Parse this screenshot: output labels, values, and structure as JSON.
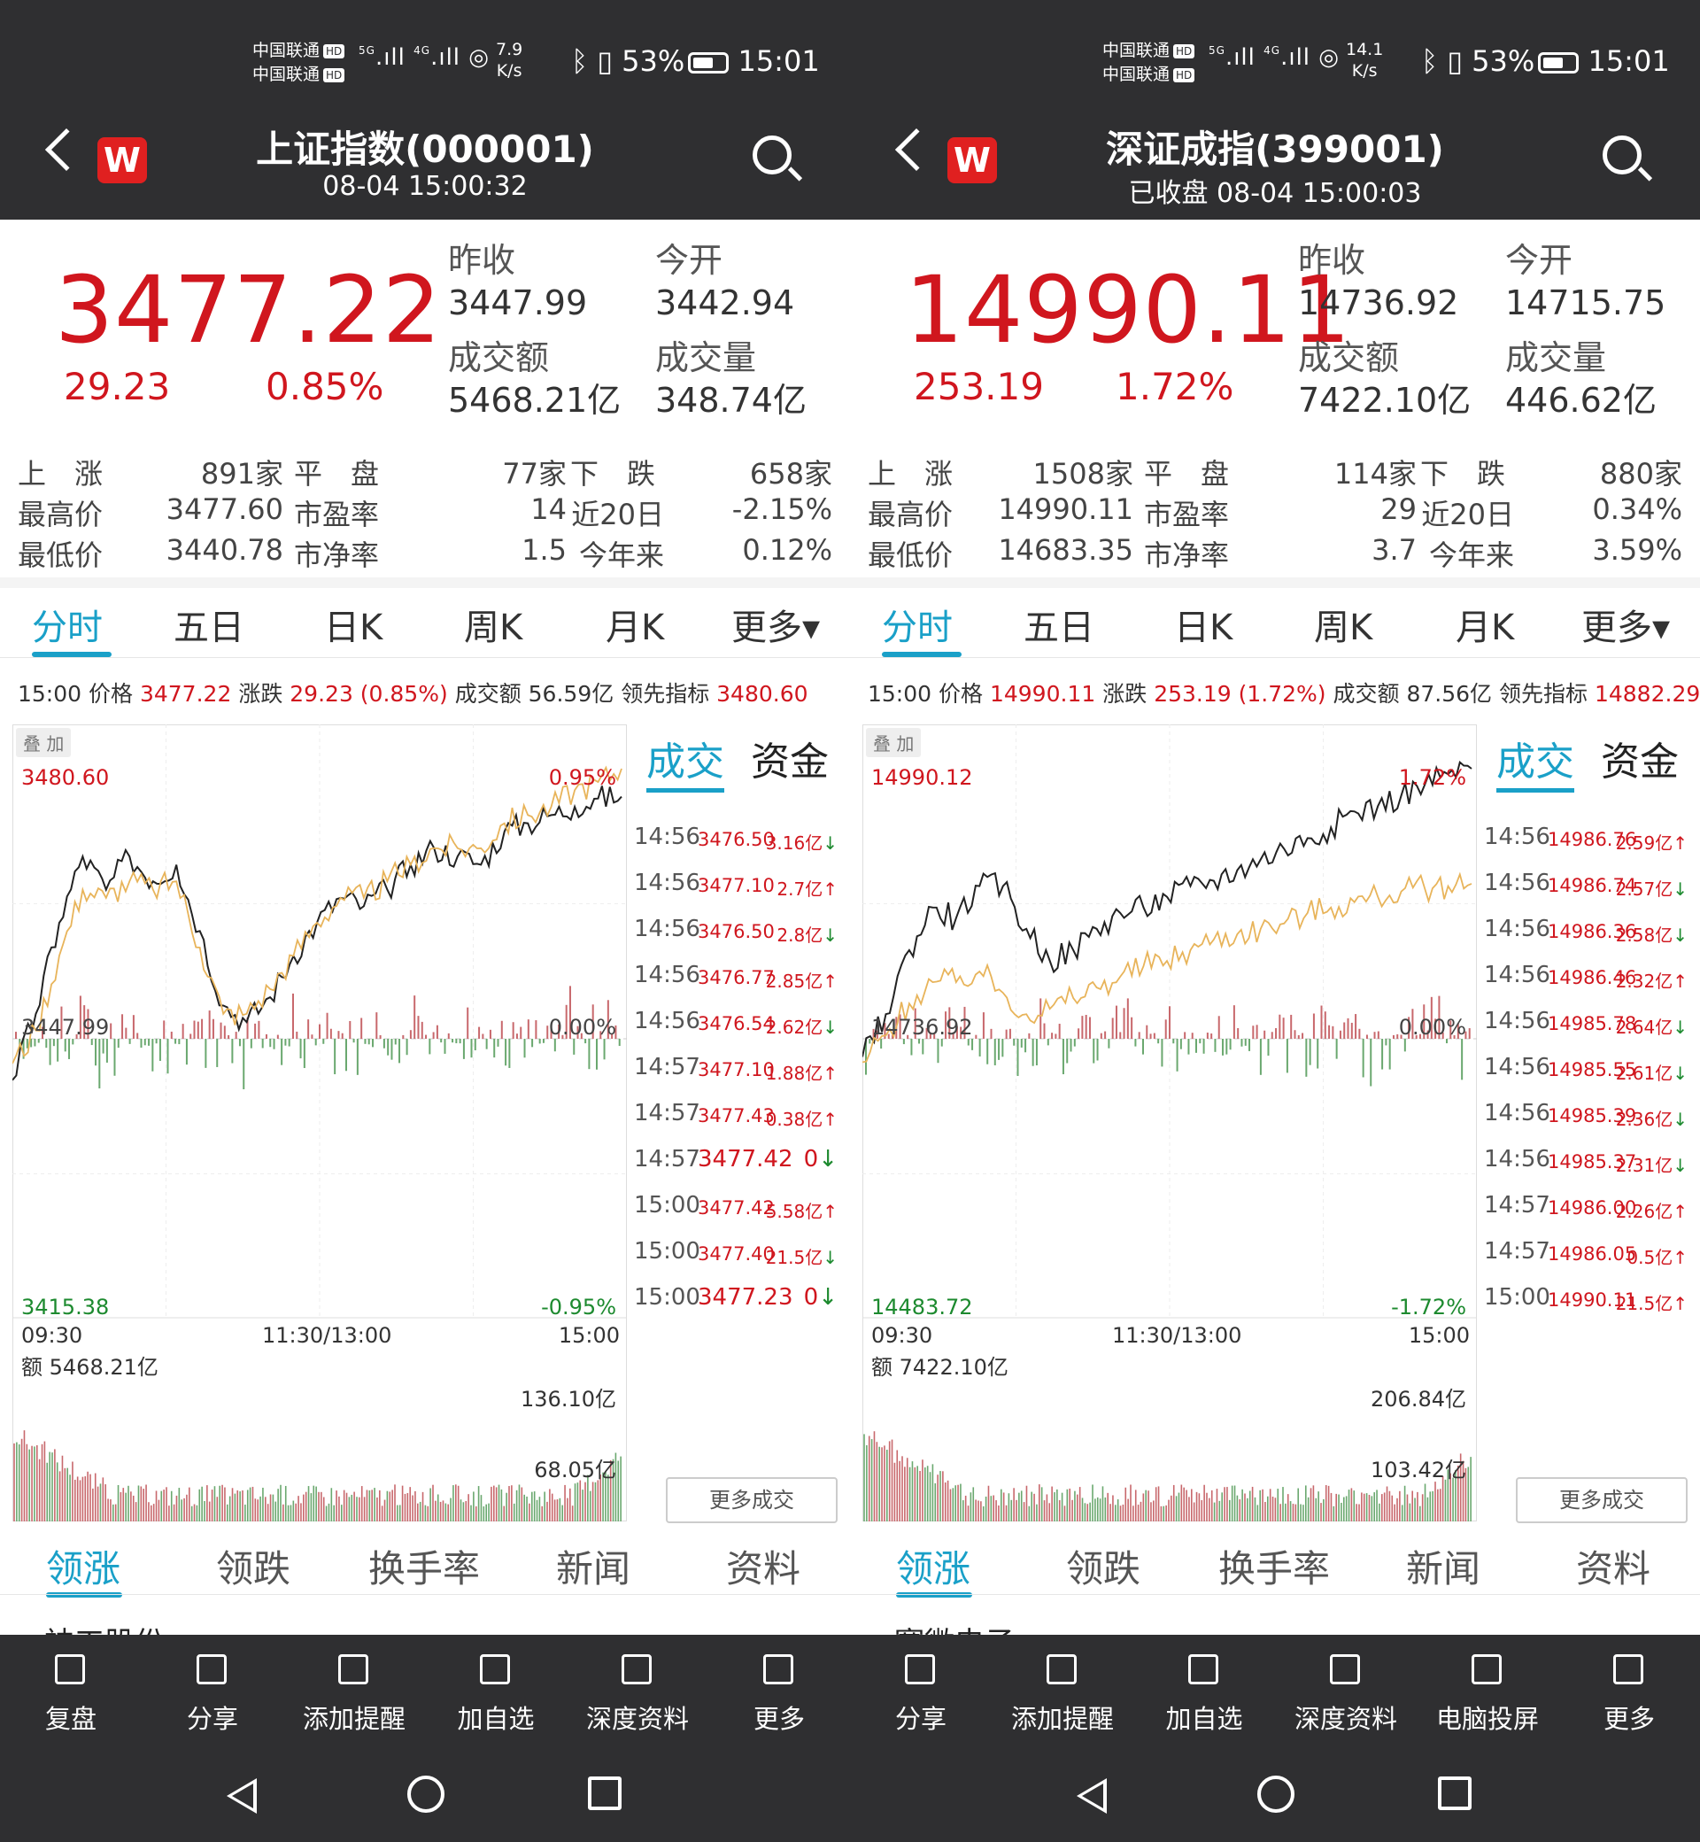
{
  "status_bar": {
    "carrier1": "中国联通",
    "carrier2": "中国联通",
    "hd": "HD",
    "battery": "53%",
    "time": "15:01",
    "network1": "5G",
    "network2": "4G"
  },
  "panels": [
    {
      "speed_value": "7.9",
      "speed_unit": "K/s",
      "title": "上证指数(000001)",
      "subtitle": "08-04 15:00:32",
      "price": "3477.22",
      "change": "29.23",
      "change_pct": "0.85%",
      "prev_close_label": "昨收",
      "prev_close": "3447.99",
      "open_label": "今开",
      "open": "3442.94",
      "turnover_label": "成交额",
      "turnover": "5468.21亿",
      "volume_label": "成交量",
      "volume": "348.74亿",
      "up_label": "上　涨",
      "up_count": "891家",
      "flat_label": "平　盘",
      "flat_count": "77家",
      "down_label": "下　跌",
      "down_count": "658家",
      "high_label": "最高价",
      "high": "3477.60",
      "pe_label": "市盈率",
      "pe": "14",
      "d20_label": "近20日",
      "d20": "-2.15%",
      "low_label": "最低价",
      "low": "3440.78",
      "pb_label": "市净率",
      "pb": "1.5",
      "ytd_label": "今年来",
      "ytd": "0.12%",
      "period_tabs": [
        "分时",
        "五日",
        "日K",
        "周K",
        "月K",
        "更多▾"
      ],
      "info": {
        "time": "15:00",
        "price_label": "价格",
        "price": "3477.22",
        "chg_label": "涨跌",
        "chg": "29.23 (0.85%)",
        "amt_label": "成交额",
        "amt": "56.59亿",
        "lead_label": "领先指标",
        "lead": "3480.60"
      },
      "overlay_label": "叠 加",
      "chart": {
        "top_price": "3480.60",
        "top_pct": "0.95%",
        "mid_price": "3447.99",
        "mid_pct": "0.00%",
        "bot_price": "3415.38",
        "bot_pct": "-0.95%",
        "t_start": "09:30",
        "t_mid": "11:30/13:00",
        "t_end": "15:00",
        "vol_label": "额",
        "vol_total": "5468.21亿",
        "vol_top": "136.10亿",
        "vol_mid": "68.05亿"
      },
      "chart_data": {
        "type": "line",
        "title": "",
        "ylim": [
          3415.38,
          3480.6
        ],
        "prev_close": 3447.99,
        "x_ticks": [
          "09:30",
          "11:30/13:00",
          "15:00"
        ],
        "series": [
          {
            "color": "#222222",
            "values": [
              3443,
              3451,
              3462,
              3470,
              3466,
              3470,
              3467,
              3469,
              3461,
              3452,
              3450,
              3453,
              3458,
              3462,
              3465,
              3464,
              3466,
              3469,
              3471,
              3470,
              3469,
              3473,
              3474,
              3475,
              3476,
              3477,
              3477.22
            ]
          },
          {
            "color": "#e8b45a",
            "values": [
              3445,
              3449,
              3458,
              3466,
              3465,
              3467,
              3466,
              3467,
              3459,
              3451,
              3451,
              3454,
              3458,
              3462,
              3465,
              3465,
              3467,
              3469,
              3471,
              3471,
              3471,
              3474,
              3475,
              3476,
              3478,
              3479,
              3480.6
            ]
          }
        ],
        "volume_ylim": [
          0,
          136.1
        ]
      },
      "trade_tabs": [
        "成交",
        "资金"
      ],
      "trades": [
        {
          "time": "14:56",
          "price": "3476.50",
          "amt": "3.16亿",
          "dir": "↓"
        },
        {
          "time": "14:56",
          "price": "3477.10",
          "amt": "2.7亿",
          "dir": "↑"
        },
        {
          "time": "14:56",
          "price": "3476.50",
          "amt": "2.8亿",
          "dir": "↓"
        },
        {
          "time": "14:56",
          "price": "3476.77",
          "amt": "2.85亿",
          "dir": "↑"
        },
        {
          "time": "14:56",
          "price": "3476.54",
          "amt": "2.62亿",
          "dir": "↓"
        },
        {
          "time": "14:57",
          "price": "3477.10",
          "amt": "1.88亿",
          "dir": "↑"
        },
        {
          "time": "14:57",
          "price": "3477.43",
          "amt": "0.38亿",
          "dir": "↑"
        },
        {
          "time": "14:57",
          "price": "3477.42",
          "amt": "0",
          "dir": "↓"
        },
        {
          "time": "15:00",
          "price": "3477.42",
          "amt": "5.58亿",
          "dir": "↑"
        },
        {
          "time": "15:00",
          "price": "3477.40",
          "amt": "21.5亿",
          "dir": "↓"
        },
        {
          "time": "15:00",
          "price": "3477.23",
          "amt": "0",
          "dir": "↓"
        }
      ],
      "more_trades": "更多成交",
      "bottom_tabs": [
        "领涨",
        "领跌",
        "换手率",
        "新闻",
        "资料"
      ],
      "peek_text": "神工股份",
      "toolbar": [
        "复盘",
        "分享",
        "添加提醒",
        "加自选",
        "深度资料",
        "更多"
      ]
    },
    {
      "speed_value": "14.1",
      "speed_unit": "K/s",
      "title": "深证成指(399001)",
      "subtitle": "已收盘 08-04 15:00:03",
      "price": "14990.11",
      "change": "253.19",
      "change_pct": "1.72%",
      "prev_close_label": "昨收",
      "prev_close": "14736.92",
      "open_label": "今开",
      "open": "14715.75",
      "turnover_label": "成交额",
      "turnover": "7422.10亿",
      "volume_label": "成交量",
      "volume": "446.62亿",
      "up_label": "上　涨",
      "up_count": "1508家",
      "flat_label": "平　盘",
      "flat_count": "114家",
      "down_label": "下　跌",
      "down_count": "880家",
      "high_label": "最高价",
      "high": "14990.11",
      "pe_label": "市盈率",
      "pe": "29",
      "d20_label": "近20日",
      "d20": "0.34%",
      "low_label": "最低价",
      "low": "14683.35",
      "pb_label": "市净率",
      "pb": "3.7",
      "ytd_label": "今年来",
      "ytd": "3.59%",
      "period_tabs": [
        "分时",
        "五日",
        "日K",
        "周K",
        "月K",
        "更多▾"
      ],
      "info": {
        "time": "15:00",
        "price_label": "价格",
        "price": "14990.11",
        "chg_label": "涨跌",
        "chg": "253.19 (1.72%)",
        "amt_label": "成交额",
        "amt": "87.56亿",
        "lead_label": "领先指标",
        "lead": "14882.29"
      },
      "overlay_label": "叠 加",
      "chart": {
        "top_price": "14990.12",
        "top_pct": "1.72%",
        "mid_price": "14736.92",
        "mid_pct": "0.00%",
        "bot_price": "14483.72",
        "bot_pct": "-1.72%",
        "t_start": "09:30",
        "t_mid": "11:30/13:00",
        "t_end": "15:00",
        "vol_label": "额",
        "vol_total": "7422.10亿",
        "vol_top": "206.84亿",
        "vol_mid": "103.42亿"
      },
      "chart_data": {
        "type": "line",
        "title": "",
        "ylim": [
          14483.72,
          14990.12
        ],
        "prev_close": 14736.92,
        "x_ticks": [
          "09:30",
          "11:30/13:00",
          "15:00"
        ],
        "series": [
          {
            "color": "#222222",
            "values": [
              14720,
              14760,
              14820,
              14860,
              14850,
              14880,
              14880,
              14840,
              14810,
              14820,
              14840,
              14855,
              14860,
              14870,
              14880,
              14885,
              14895,
              14905,
              14915,
              14925,
              14935,
              14950,
              14955,
              14965,
              14975,
              14985,
              14990.11
            ]
          },
          {
            "color": "#e8b45a",
            "values": [
              14715,
              14740,
              14770,
              14790,
              14790,
              14800,
              14780,
              14760,
              14765,
              14775,
              14785,
              14795,
              14805,
              14810,
              14820,
              14830,
              14835,
              14840,
              14845,
              14855,
              14860,
              14865,
              14870,
              14875,
              14878,
              14880,
              14882.29
            ]
          }
        ],
        "volume_ylim": [
          0,
          206.84
        ]
      },
      "trade_tabs": [
        "成交",
        "资金"
      ],
      "trades": [
        {
          "time": "14:56",
          "price": "14986.76",
          "amt": "2.59亿",
          "dir": "↑"
        },
        {
          "time": "14:56",
          "price": "14986.74",
          "amt": "2.57亿",
          "dir": "↓"
        },
        {
          "time": "14:56",
          "price": "14986.36",
          "amt": "2.58亿",
          "dir": "↓"
        },
        {
          "time": "14:56",
          "price": "14986.46",
          "amt": "2.32亿",
          "dir": "↑"
        },
        {
          "time": "14:56",
          "price": "14985.78",
          "amt": "2.64亿",
          "dir": "↓"
        },
        {
          "time": "14:56",
          "price": "14985.55",
          "amt": "2.61亿",
          "dir": "↓"
        },
        {
          "time": "14:56",
          "price": "14985.39",
          "amt": "2.36亿",
          "dir": "↓"
        },
        {
          "time": "14:56",
          "price": "14985.37",
          "amt": "2.31亿",
          "dir": "↓"
        },
        {
          "time": "14:57",
          "price": "14986.00",
          "amt": "2.26亿",
          "dir": "↑"
        },
        {
          "time": "14:57",
          "price": "14986.05",
          "amt": "0.5亿",
          "dir": "↑"
        },
        {
          "time": "15:00",
          "price": "14990.11",
          "amt": "21.5亿",
          "dir": "↑"
        }
      ],
      "more_trades": "更多成交",
      "bottom_tabs": [
        "领涨",
        "领跌",
        "换手率",
        "新闻",
        "资料"
      ],
      "peek_text": "赛微电子",
      "toolbar": [
        "分享",
        "添加提醒",
        "加自选",
        "深度资料",
        "电脑投屏",
        "更多"
      ]
    }
  ]
}
